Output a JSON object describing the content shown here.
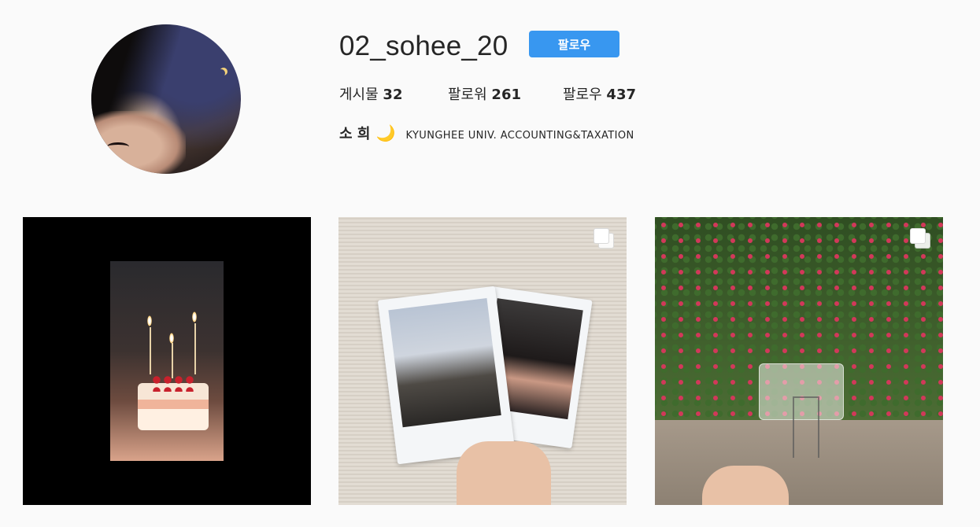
{
  "profile": {
    "username": "02_sohee_20",
    "follow_button": "팔로우",
    "stats": {
      "posts_label": "게시물",
      "posts_count": "32",
      "followers_label": "팔로워",
      "followers_count": "261",
      "following_label": "팔로우",
      "following_count": "437"
    },
    "bio": {
      "name": "소 희",
      "emoji": "🌙",
      "description": "KYUNGHEE UNIV. ACCOUNTING&TAXATION"
    }
  },
  "posts": [
    {
      "subject": "birthday cake with candles",
      "multi": false
    },
    {
      "subject": "two instant photos held in hand",
      "multi": true
    },
    {
      "subject": "clear card in front of flower bush",
      "multi": true
    }
  ],
  "icons": {
    "multi_post": "multiple-photos-icon"
  },
  "colors": {
    "follow_button": "#3897f0",
    "background": "#fafafa",
    "text": "#262626"
  }
}
